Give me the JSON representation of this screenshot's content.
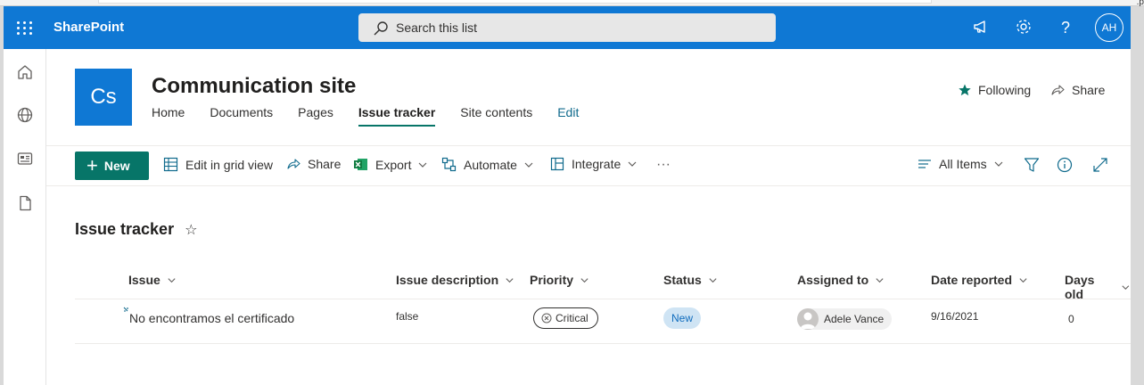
{
  "suite": {
    "brand": "SharePoint",
    "search_placeholder": "Search this list",
    "avatar_initials": "AH"
  },
  "site": {
    "logo_text": "Cs",
    "title": "Communication site",
    "nav": [
      "Home",
      "Documents",
      "Pages",
      "Issue tracker",
      "Site contents",
      "Edit"
    ],
    "active_nav": "Issue tracker",
    "following_label": "Following",
    "share_label": "Share"
  },
  "commandbar": {
    "new_label": "New",
    "edit_grid_label": "Edit in grid view",
    "share_label": "Share",
    "export_label": "Export",
    "automate_label": "Automate",
    "integrate_label": "Integrate",
    "more_label": "···",
    "view_label": "All Items"
  },
  "list": {
    "title": "Issue tracker",
    "columns": [
      "Issue",
      "Issue description",
      "Priority",
      "Status",
      "Assigned to",
      "Date reported",
      "Days old"
    ],
    "rows": [
      {
        "issue": "No encontramos el certificado",
        "description": "false",
        "priority": "Critical",
        "status": "New",
        "assigned_to": "Adele Vance",
        "date_reported": "9/16/2021",
        "days_old": "0"
      }
    ]
  },
  "colors": {
    "suite_blue": "#0f78d4",
    "accent_teal": "#077568",
    "status_new_bg": "#cfe4f4"
  },
  "icons": [
    "waffle-icon",
    "search-icon",
    "megaphone-icon",
    "gear-icon",
    "help-icon",
    "home-icon",
    "globe-icon",
    "news-icon",
    "page-icon",
    "star-icon",
    "share-icon",
    "grid-icon",
    "excel-icon",
    "automate-icon",
    "integrate-icon",
    "view-icon",
    "filter-icon",
    "info-icon",
    "expand-icon",
    "chevron-down-icon"
  ]
}
